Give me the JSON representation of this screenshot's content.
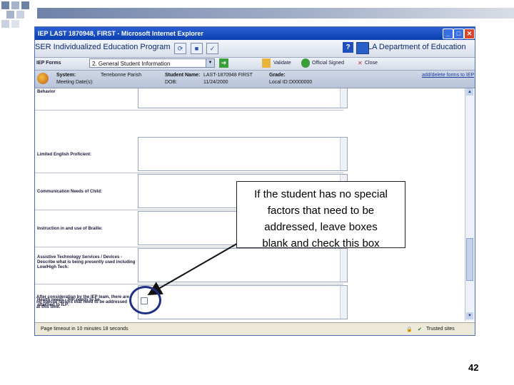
{
  "window": {
    "title": "IEP LAST 1870948, FIRST - Microsoft Internet Explorer",
    "minimize_glyph": "_",
    "maximize_glyph": "□",
    "close_glyph": "✕"
  },
  "app": {
    "title": "SER Individualized Education Program",
    "department": "LA Department of Education",
    "help_glyph": "?"
  },
  "forms_bar": {
    "label": "IEP Forms",
    "selected_form": "2. General Student Information",
    "validate_label": "Validate",
    "official_signed_label": "Official Signed",
    "close_label": "Close"
  },
  "student_bar": {
    "system_label": "System:",
    "system_value": "Terrebonne Parish",
    "student_name_label": "Student Name:",
    "student_name_value": "LAST-1870948 FIRST",
    "grade_label": "Grade:",
    "grade_value": "",
    "meeting_date_label": "Meeting Date(s):",
    "dob_label": "DOB:",
    "dob_value": "11/24/2000",
    "local_id_label": "Local ID:",
    "local_id_value": "D0000000",
    "add_delete_link": "add/delete forms to IEP"
  },
  "fields": [
    {
      "label": "Behavior"
    },
    {
      "label": "Limited English Proficient:"
    },
    {
      "label": "Communication Needs of Child:"
    },
    {
      "label": "Instruction in and use of Braille:"
    },
    {
      "label": "Assistive Technology Services / Devices - Describe what is being presently used including Low/High Tech:"
    },
    {
      "label": "Health needs - IHP needs to be attached to ILP:"
    },
    {
      "label": "After consideration by the IEP team, there are no special factors that need to be addressed at this time."
    }
  ],
  "status_bar": {
    "left_text": "Page timeout in 10 minutes 18 seconds",
    "zone_text": "Trusted sites"
  },
  "callout": {
    "lines": [
      "If the student has no special",
      "factors that need to be",
      "addressed, leave boxes",
      "blank and check this box"
    ]
  },
  "slide": {
    "page_number": "42"
  },
  "colors": {
    "title_blue": "#0a3fb0",
    "circle_navy": "#1f2f86",
    "squares": "#6e82a8"
  }
}
